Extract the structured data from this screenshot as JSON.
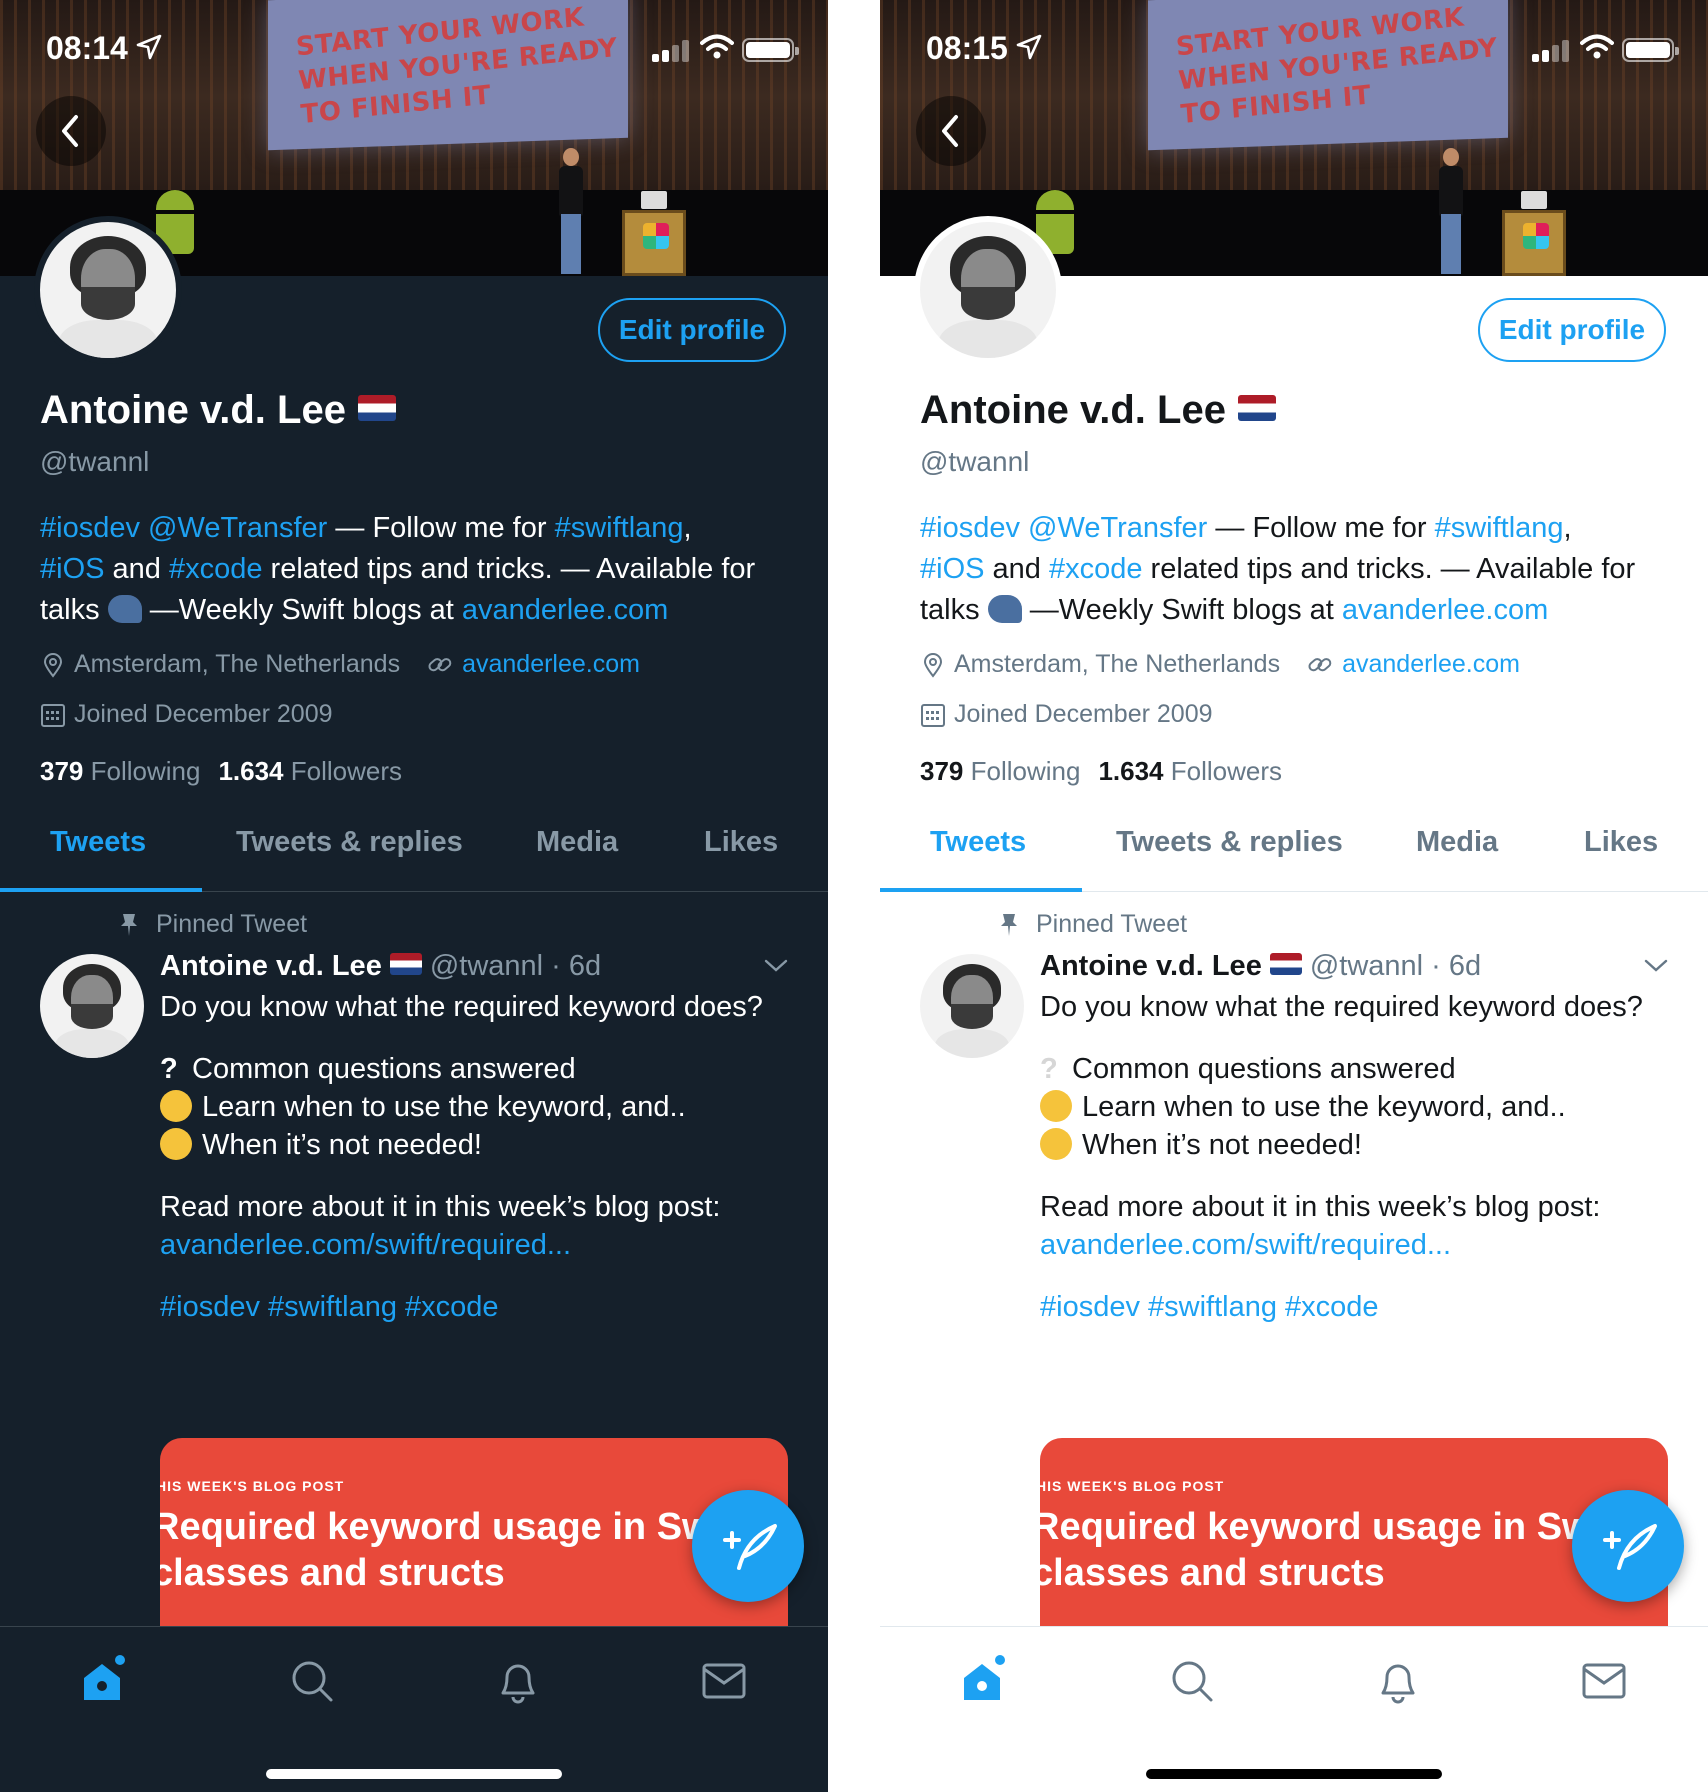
{
  "colors": {
    "accent": "#1da1f2",
    "dark_bg": "#15202b",
    "light_bg": "#ffffff",
    "card_bg": "#e8493a"
  },
  "banner": {
    "screen_text": "START YOUR WORK WHEN YOU'RE READY TO FINISH IT"
  },
  "profile": {
    "edit_label": "Edit profile",
    "name": "Antoine v.d. Lee",
    "handle": "@twannl",
    "bio": {
      "tag_iosdev": "#iosdev",
      "mention": "@WeTransfer",
      "text1": " — Follow me for ",
      "tag_swiftlang": "#swiftlang",
      "text2": ",",
      "tag_ios": "#iOS",
      "text3": " and ",
      "tag_xcode": "#xcode",
      "text4": " related tips and tricks. — Available for talks ",
      "text5": " —Weekly Swift blogs at ",
      "site": "avanderlee.com"
    },
    "location": "Amsterdam, The Netherlands",
    "website": "avanderlee.com",
    "joined": "Joined December 2009",
    "following_count": "379",
    "following_label": "Following",
    "followers_count": "1.634",
    "followers_label": "Followers"
  },
  "tabs": [
    "Tweets",
    "Tweets & replies",
    "Media",
    "Likes"
  ],
  "tweet": {
    "pinned_label": "Pinned Tweet",
    "author": "Antoine v.d. Lee",
    "handle_time": "@twannl · 6d",
    "line1": "Do you know what the required keyword does?",
    "bullet1": "Common questions answered",
    "bullet2": "Learn when to use the keyword, and..",
    "bullet3": "When it’s not needed!",
    "read_more": "Read more about it in this week’s blog post:",
    "url": "avanderlee.com/swift/required...",
    "hashtags": "#iosdev #swiftlang #xcode",
    "card_kicker": "HIS WEEK'S BLOG POST",
    "card_title": "Required keyword usage in Swift classes and structs"
  },
  "screens": [
    {
      "theme": "dark",
      "time": "08:14"
    },
    {
      "theme": "light",
      "time": "08:15"
    }
  ],
  "icons": {
    "back": "chevron-left-icon",
    "location": "location-pin-icon",
    "link": "link-icon",
    "calendar": "calendar-icon",
    "pin": "pin-icon",
    "compose": "compose-tweet-icon",
    "home": "home-icon",
    "search": "search-icon",
    "notifications": "bell-icon",
    "messages": "mail-icon"
  }
}
